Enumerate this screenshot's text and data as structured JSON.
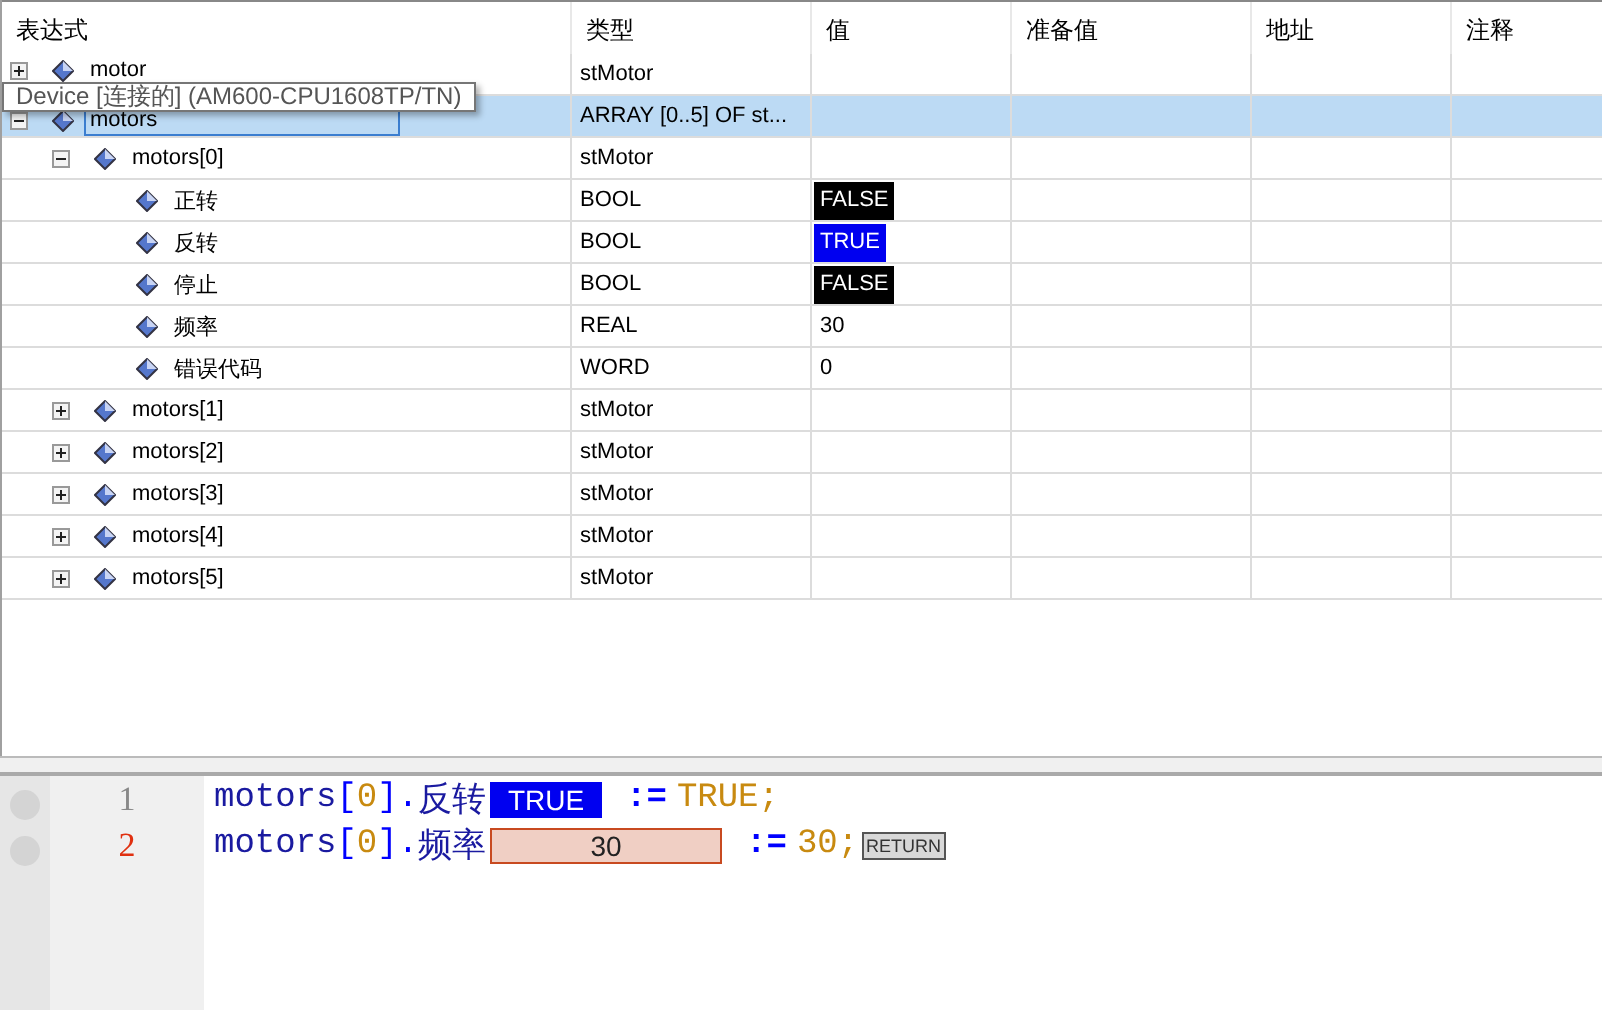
{
  "table": {
    "columns": [
      "表达式",
      "类型",
      "值",
      "准备值",
      "地址",
      "注释"
    ],
    "rows": [
      {
        "expression": "motor",
        "type": "stMotor",
        "expanded": false,
        "selected": false
      },
      {
        "expression": "motors",
        "type": "ARRAY [0..5] OF st...",
        "expanded": true,
        "selected": true,
        "children": [
          {
            "expression": "motors[0]",
            "type": "stMotor",
            "expanded": true,
            "selected": false,
            "children": [
              {
                "expression": "正转",
                "type": "BOOL",
                "value": {
                  "text": "FALSE",
                  "kind": "bool",
                  "on": false
                },
                "selected": false
              },
              {
                "expression": "反转",
                "type": "BOOL",
                "value": {
                  "text": "TRUE",
                  "kind": "bool",
                  "on": true
                },
                "selected": false
              },
              {
                "expression": "停止",
                "type": "BOOL",
                "value": {
                  "text": "FALSE",
                  "kind": "bool",
                  "on": false
                },
                "selected": false
              },
              {
                "expression": "频率",
                "type": "REAL",
                "value": {
                  "text": "30",
                  "kind": "number"
                },
                "selected": false
              },
              {
                "expression": "错误代码",
                "type": "WORD",
                "value": {
                  "text": "0",
                  "kind": "number"
                },
                "selected": false
              }
            ]
          },
          {
            "expression": "motors[1]",
            "type": "stMotor",
            "expanded": false,
            "selected": false
          },
          {
            "expression": "motors[2]",
            "type": "stMotor",
            "expanded": false,
            "selected": false
          },
          {
            "expression": "motors[3]",
            "type": "stMotor",
            "expanded": false,
            "selected": false
          },
          {
            "expression": "motors[4]",
            "type": "stMotor",
            "expanded": false,
            "selected": false
          },
          {
            "expression": "motors[5]",
            "type": "stMotor",
            "expanded": false,
            "selected": false
          }
        ]
      }
    ]
  },
  "tooltip": "Device [连接的] (AM600-CPU1608TP/TN)",
  "editor": {
    "lines": [
      {
        "number": "1",
        "current": false,
        "tokens": [
          {
            "text": "motors",
            "kind": "ident"
          },
          {
            "text": "[",
            "kind": "punct"
          },
          {
            "text": "0",
            "kind": "literal"
          },
          {
            "text": "].",
            "kind": "punct"
          },
          {
            "text": "反转",
            "kind": "ident"
          }
        ],
        "monitor": {
          "text": "TRUE",
          "kind": "bool",
          "on": true
        },
        "after": [
          {
            "text": ":=",
            "kind": "op"
          },
          {
            "text": "TRUE;",
            "kind": "literal"
          }
        ]
      },
      {
        "number": "2",
        "current": true,
        "tokens": [
          {
            "text": "motors",
            "kind": "ident"
          },
          {
            "text": "[",
            "kind": "punct"
          },
          {
            "text": "0",
            "kind": "literal"
          },
          {
            "text": "].",
            "kind": "punct"
          },
          {
            "text": "频率",
            "kind": "ident"
          }
        ],
        "monitor": {
          "text": "30",
          "kind": "number"
        },
        "after": [
          {
            "text": ":=",
            "kind": "op"
          },
          {
            "text": "30;",
            "kind": "literal"
          }
        ],
        "badge": "RETURN"
      }
    ]
  }
}
